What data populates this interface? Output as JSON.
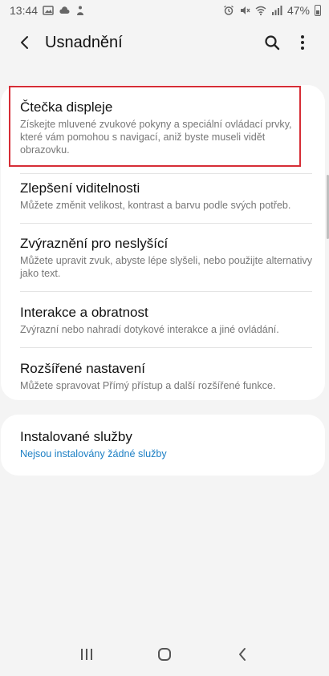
{
  "status_bar": {
    "time": "13:44",
    "battery": "47%",
    "left_icons": [
      "image-icon",
      "cloud-icon",
      "alert-person-icon"
    ],
    "right_icons": [
      "alarm-icon",
      "mute-icon",
      "wifi-icon",
      "signal-icon",
      "battery-icon"
    ]
  },
  "header": {
    "title": "Usnadnění",
    "back_icon": "back-arrow-icon",
    "search_icon": "search-icon",
    "more_icon": "more-vert-icon"
  },
  "sections": {
    "main": [
      {
        "title": "Čtečka displeje",
        "description": "Získejte mluvené zvukové pokyny a speciální ovládací prvky, které vám pomohou s navigací, aniž byste museli vidět obrazovku."
      },
      {
        "title": "Zlepšení viditelnosti",
        "description": "Můžete změnit velikost, kontrast a barvu podle svých potřeb."
      },
      {
        "title": "Zvýraznění pro neslyšící",
        "description": "Můžete upravit zvuk, abyste lépe slyšeli, nebo použijte alternativy jako text."
      },
      {
        "title": "Interakce a obratnost",
        "description": "Zvýrazní nebo nahradí dotykové interakce a jiné ovládání."
      },
      {
        "title": "Rozšířené nastavení",
        "description": "Můžete spravovat Přímý přístup a další rozšířené funkce."
      }
    ],
    "services": {
      "title": "Instalované služby",
      "description": "Nejsou instalovány žádné služby"
    }
  },
  "colors": {
    "background": "#f4f4f4",
    "card": "#ffffff",
    "link_blue": "#1c7fc4",
    "highlight_red": "#d62d36"
  },
  "nav_bar": {
    "icons": [
      "recent-apps-icon",
      "home-icon",
      "back-icon"
    ]
  }
}
